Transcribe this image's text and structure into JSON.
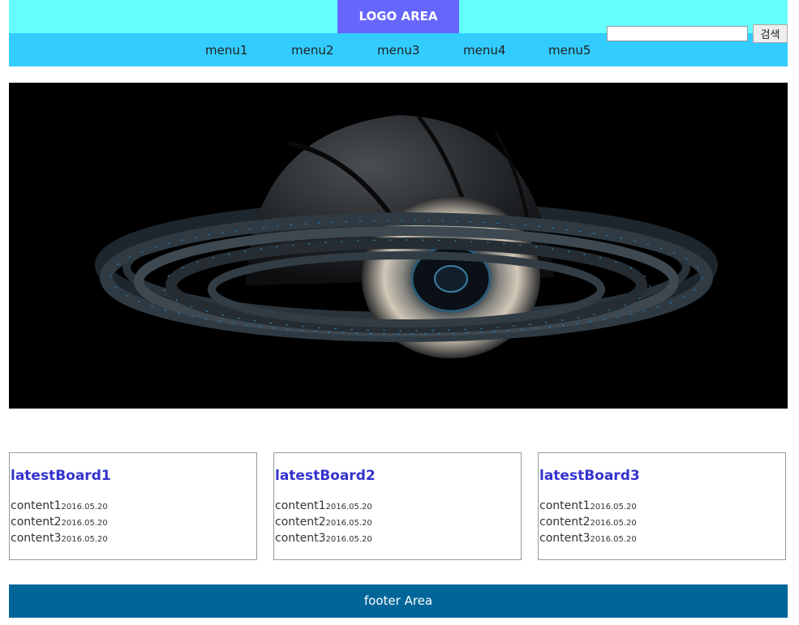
{
  "header": {
    "logo": "LOGO AREA",
    "menu": [
      {
        "label": "menu1"
      },
      {
        "label": "menu2"
      },
      {
        "label": "menu3"
      },
      {
        "label": "menu4"
      },
      {
        "label": "menu5"
      }
    ],
    "search": {
      "value": "",
      "placeholder": "",
      "button_label": "검색"
    }
  },
  "boards": [
    {
      "title": "latestBoard1",
      "items": [
        {
          "text": "content1",
          "date": "2016.05.20"
        },
        {
          "text": "content2",
          "date": "2016.05.20"
        },
        {
          "text": "content3",
          "date": "2016.05.20"
        }
      ]
    },
    {
      "title": "latestBoard2",
      "items": [
        {
          "text": "content1",
          "date": "2016.05.20"
        },
        {
          "text": "content2",
          "date": "2016.05.20"
        },
        {
          "text": "content3",
          "date": "2016.05.20"
        }
      ]
    },
    {
      "title": "latestBoard3",
      "items": [
        {
          "text": "content1",
          "date": "2016.05.20"
        },
        {
          "text": "content2",
          "date": "2016.05.20"
        },
        {
          "text": "content3",
          "date": "2016.05.20"
        }
      ]
    }
  ],
  "footer": {
    "text": "footer Area"
  },
  "colors": {
    "top_band": "#66ffff",
    "logo_bg": "#6666ff",
    "nav_band": "#33ccff",
    "board_title": "#3333cc",
    "footer_bg": "#006699"
  }
}
